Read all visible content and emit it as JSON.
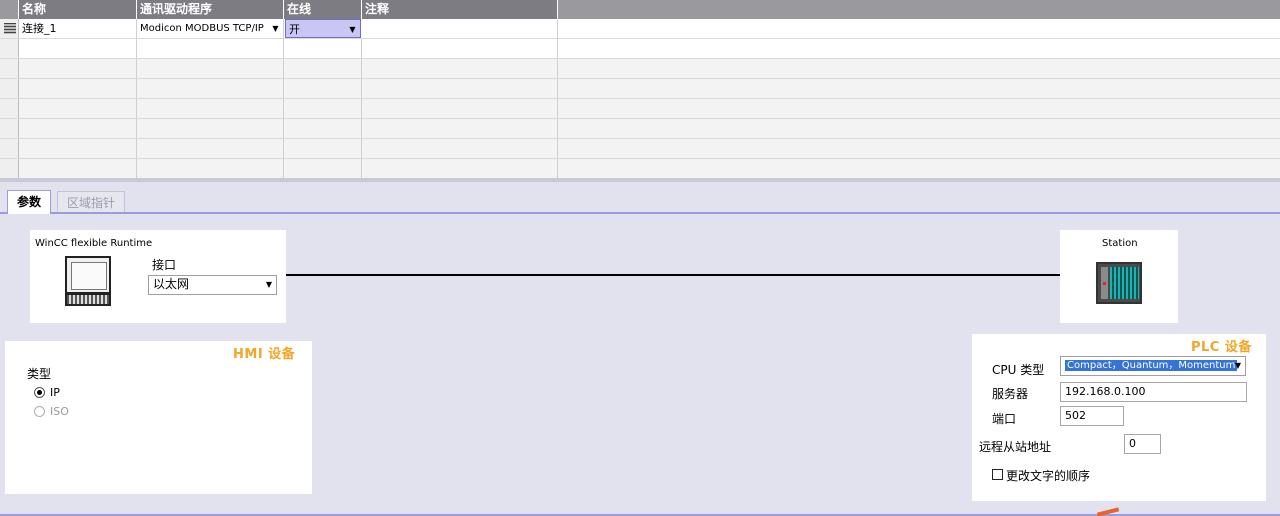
{
  "grid": {
    "columns": [
      "名称",
      "通讯驱动程序",
      "在线",
      "注释"
    ],
    "rows": [
      {
        "name": "连接_1",
        "driver": "Modicon MODBUS TCP/IP",
        "online": "开",
        "comment": ""
      }
    ]
  },
  "tabs": [
    {
      "label": "参数",
      "active": true
    },
    {
      "label": "区域指针",
      "active": false
    }
  ],
  "diagram": {
    "hmi_caption": "WinCC flexible Runtime",
    "interface_label": "接口",
    "interface_value": "以太网",
    "station_caption": "Station"
  },
  "hmi_settings": {
    "title": "HMI 设备",
    "type_label": "类型",
    "options": [
      {
        "label": "IP",
        "selected": true,
        "enabled": true
      },
      {
        "label": "ISO",
        "selected": false,
        "enabled": false
      }
    ]
  },
  "plc_settings": {
    "title": "PLC 设备",
    "cpu_type_label": "CPU 类型",
    "cpu_type_value": "Compact，Quantum，Momentum",
    "server_label": "服务器",
    "server_value": "192.168.0.100",
    "port_label": "端口",
    "port_value": "502",
    "remote_slave_label": "远程从站地址",
    "remote_slave_value": "0",
    "change_word_order_label": "更改文字的顺序",
    "change_word_order_checked": false
  },
  "colors": {
    "accent_title": "#f0a628",
    "selection": "#3574d6",
    "tab_border": "#9b9be0"
  }
}
